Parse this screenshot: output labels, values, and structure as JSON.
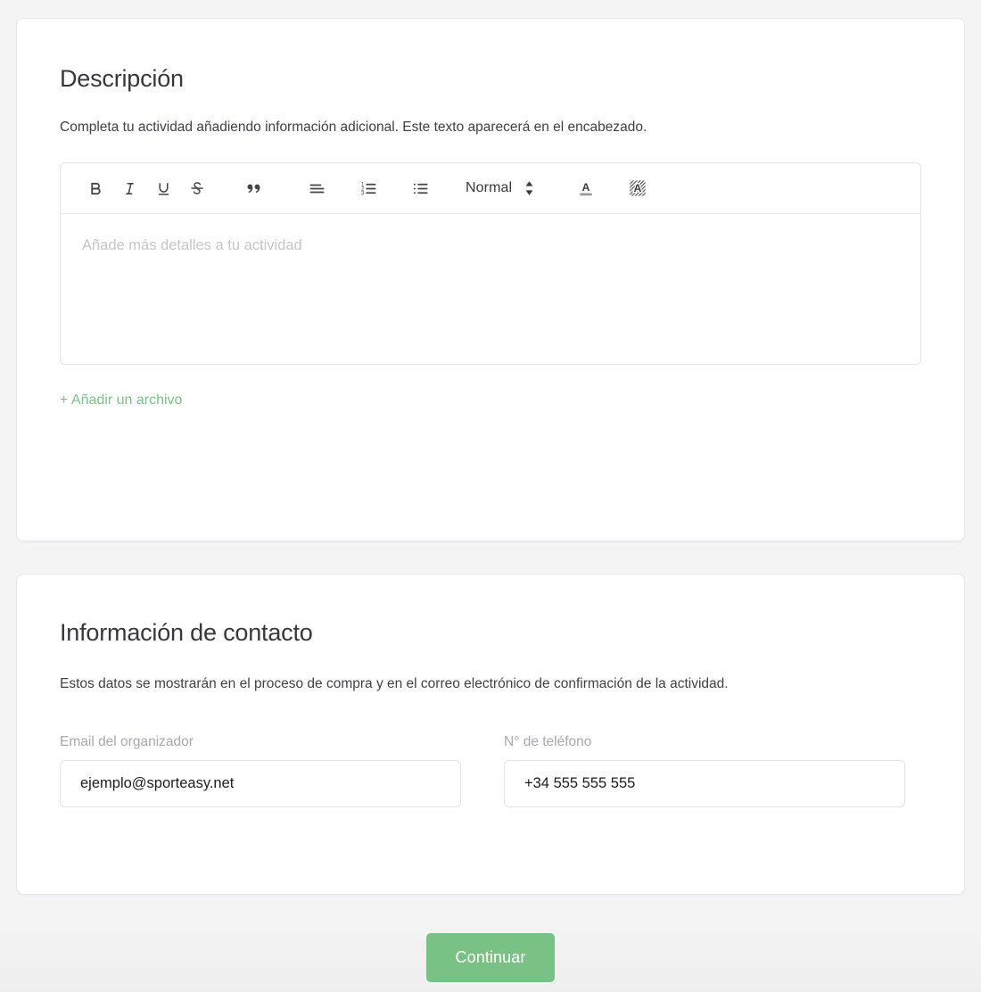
{
  "description_section": {
    "title": "Descripción",
    "subtitle": "Completa tu actividad añadiendo información adicional. Este texto aparecerá en el encabezado.",
    "editor": {
      "placeholder": "Añade más detalles a tu actividad",
      "value": "",
      "toolbar": {
        "bold": "B",
        "italic": "I",
        "underline": "U",
        "strikethrough": "S",
        "blockquote": "”",
        "align": "align-left",
        "ordered_list": "ordered-list",
        "bullet_list": "bullet-list",
        "format_label": "Normal",
        "format_arrow": "select-arrows",
        "text_color": "A",
        "background_color": "A"
      }
    },
    "add_file_label": "+ Añadir un archivo"
  },
  "contact_section": {
    "title": "Información de contacto",
    "subtitle": "Estos datos se mostrarán en el proceso de compra y en el correo electrónico de confirmación de la actividad.",
    "fields": [
      {
        "label": "Email del organizador",
        "value": "ejemplo@sporteasy.net",
        "placeholder": "ejemplo@sporteasy.net"
      },
      {
        "label": "N° de teléfono",
        "value": "+34 555 555 555",
        "placeholder": "+34 555 555 555"
      }
    ]
  },
  "footer": {
    "continue_label": "Continuar"
  },
  "colors": {
    "accent_green": "#79c184",
    "link_green": "#7cc088",
    "page_background": "#f4f4f5",
    "card_background": "#ffffff",
    "border": "#e3e3e9",
    "heading_text": "#37373d",
    "body_text": "#3f3f46",
    "muted_text": "#a7a8b0",
    "placeholder_text": "#c3c5cd"
  }
}
